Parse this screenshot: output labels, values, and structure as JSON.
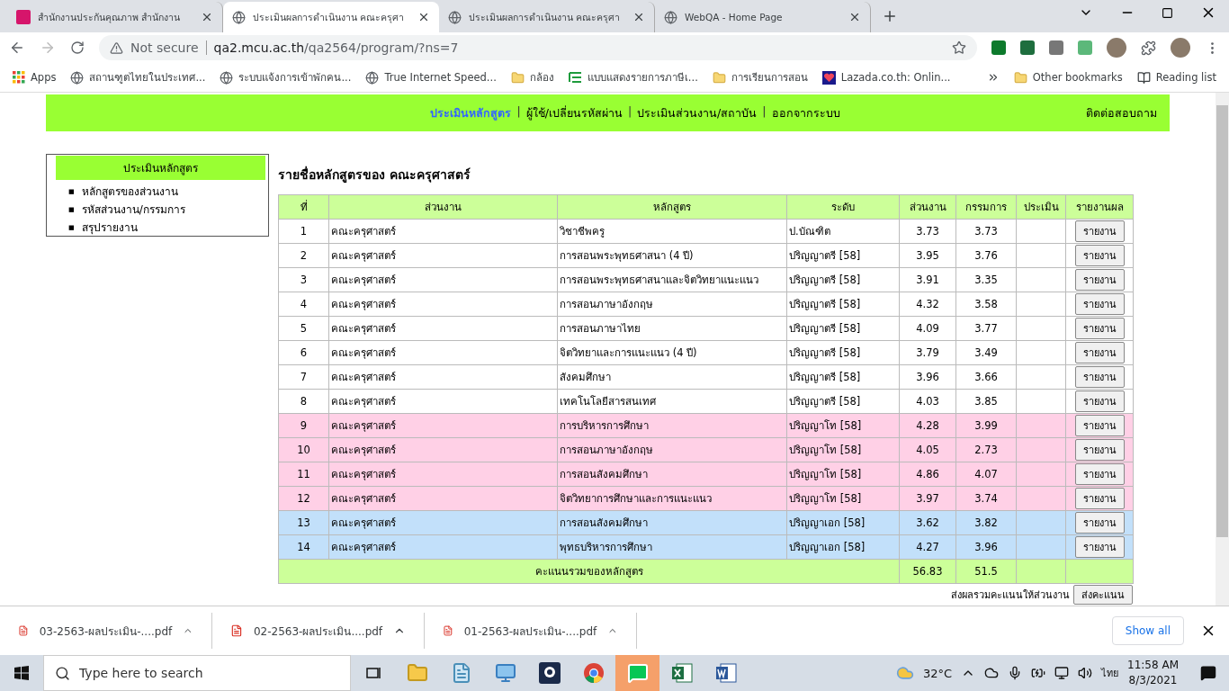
{
  "browser": {
    "tabs": [
      {
        "title": "สำนักงานประกันคุณภาพ สำนักงาน",
        "kind": "logo",
        "selected": false
      },
      {
        "title": "ประเมินผลการดำเนินงาน คณะครุศา",
        "kind": "globe",
        "selected": true
      },
      {
        "title": "ประเมินผลการดำเนินงาน คณะครุศา",
        "kind": "globe",
        "selected": false
      },
      {
        "title": "WebQA - Home Page",
        "kind": "globe",
        "selected": false
      }
    ],
    "address": {
      "security": "Not secure",
      "host": "qa2.mcu.ac.th",
      "path": "/qa2564/program/?ns=7"
    },
    "bookmarks": [
      {
        "label": "Apps",
        "kind": "apps"
      },
      {
        "label": "สถานฑูตไทยในประเทศ...",
        "kind": "globe"
      },
      {
        "label": "ระบบแจ้งการเข้าพักคน...",
        "kind": "globe"
      },
      {
        "label": "True Internet Speed...",
        "kind": "globe"
      },
      {
        "label": "กล้อง",
        "kind": "folder"
      },
      {
        "label": "แบบแสดงรายการภาษีเ...",
        "kind": "list"
      },
      {
        "label": "การเรียนการสอน",
        "kind": "folder"
      },
      {
        "label": "Lazada.co.th: Onlin...",
        "kind": "lazada"
      }
    ],
    "other_bookmarks": "Other bookmarks",
    "reading_list": "Reading list"
  },
  "page": {
    "nav": [
      {
        "label": "ประเมินหลักสูตร",
        "selected": true
      },
      {
        "label": "ผู้ใช้/เปลี่ยนรหัสผ่าน",
        "selected": false
      },
      {
        "label": "ประเมินส่วนงาน/สถาบัน",
        "selected": false
      },
      {
        "label": "ออกจากระบบ",
        "selected": false
      }
    ],
    "nav_separator": "|",
    "contact": "ติดต่อสอบถาม",
    "sidebar": {
      "title": "ประเมินหลักสูตร",
      "bullet": "■",
      "items": [
        "หลักสูตรของส่วนงาน",
        "รหัสส่วนงาน/กรรมการ",
        "สรุปรายงาน"
      ]
    },
    "heading": "รายชื่อหลักสูตรของ คณะครุศาสตร์",
    "table": {
      "columns": [
        "ที่",
        "ส่วนงาน",
        "หลักสูตร",
        "ระดับ",
        "ส่วนงาน",
        "กรรมการ",
        "ประเมิน",
        "รายงานผล"
      ],
      "rows": [
        {
          "no": "1",
          "unit": "คณะครุศาสตร์",
          "program": "วิชาชีพครู",
          "level": "ป.บัณฑิต",
          "unit_score": "3.73",
          "committee_score": "3.73",
          "button": "รายงาน",
          "color": "#ffffff"
        },
        {
          "no": "2",
          "unit": "คณะครุศาสตร์",
          "program": "การสอนพระพุทธศาสนา (4 ปี)",
          "level": "ปริญญาตรี [58]",
          "unit_score": "3.95",
          "committee_score": "3.76",
          "button": "รายงาน",
          "color": "#ffffff"
        },
        {
          "no": "3",
          "unit": "คณะครุศาสตร์",
          "program": "การสอนพระพุทธศาสนาและจิตวิทยาแนะแนว",
          "level": "ปริญญาตรี [58]",
          "unit_score": "3.91",
          "committee_score": "3.35",
          "button": "รายงาน",
          "color": "#ffffff"
        },
        {
          "no": "4",
          "unit": "คณะครุศาสตร์",
          "program": "การสอนภาษาอังกฤษ",
          "level": "ปริญญาตรี [58]",
          "unit_score": "4.32",
          "committee_score": "3.58",
          "button": "รายงาน",
          "color": "#ffffff"
        },
        {
          "no": "5",
          "unit": "คณะครุศาสตร์",
          "program": "การสอนภาษาไทย",
          "level": "ปริญญาตรี [58]",
          "unit_score": "4.09",
          "committee_score": "3.77",
          "button": "รายงาน",
          "color": "#ffffff"
        },
        {
          "no": "6",
          "unit": "คณะครุศาสตร์",
          "program": "จิตวิทยาและการแนะแนว (4 ปี)",
          "level": "ปริญญาตรี [58]",
          "unit_score": "3.79",
          "committee_score": "3.49",
          "button": "รายงาน",
          "color": "#ffffff"
        },
        {
          "no": "7",
          "unit": "คณะครุศาสตร์",
          "program": "สังคมศึกษา",
          "level": "ปริญญาตรี [58]",
          "unit_score": "3.96",
          "committee_score": "3.66",
          "button": "รายงาน",
          "color": "#ffffff"
        },
        {
          "no": "8",
          "unit": "คณะครุศาสตร์",
          "program": "เทคโนโลยีสารสนเทศ",
          "level": "ปริญญาตรี [58]",
          "unit_score": "4.03",
          "committee_score": "3.85",
          "button": "รายงาน",
          "color": "#ffffff"
        },
        {
          "no": "9",
          "unit": "คณะครุศาสตร์",
          "program": "การบริหารการศึกษา",
          "level": "ปริญญาโท [58]",
          "unit_score": "4.28",
          "committee_score": "3.99",
          "button": "รายงาน",
          "color": "#ffd0e6"
        },
        {
          "no": "10",
          "unit": "คณะครุศาสตร์",
          "program": "การสอนภาษาอังกฤษ",
          "level": "ปริญญาโท [58]",
          "unit_score": "4.05",
          "committee_score": "2.73",
          "button": "รายงาน",
          "color": "#ffd0e6"
        },
        {
          "no": "11",
          "unit": "คณะครุศาสตร์",
          "program": "การสอนสังคมศึกษา",
          "level": "ปริญญาโท [58]",
          "unit_score": "4.86",
          "committee_score": "4.07",
          "button": "รายงาน",
          "color": "#ffd0e6"
        },
        {
          "no": "12",
          "unit": "คณะครุศาสตร์",
          "program": "จิตวิทยาการศึกษาและการแนะแนว",
          "level": "ปริญญาโท [58]",
          "unit_score": "3.97",
          "committee_score": "3.74",
          "button": "รายงาน",
          "color": "#ffd0e6"
        },
        {
          "no": "13",
          "unit": "คณะครุศาสตร์",
          "program": "การสอนสังคมศึกษา",
          "level": "ปริญญาเอก [58]",
          "unit_score": "3.62",
          "committee_score": "3.82",
          "button": "รายงาน",
          "color": "#c2e0fa"
        },
        {
          "no": "14",
          "unit": "คณะครุศาสตร์",
          "program": "พุทธบริหารการศึกษา",
          "level": "ปริญญาเอก [58]",
          "unit_score": "4.27",
          "committee_score": "3.96",
          "button": "รายงาน",
          "color": "#c2e0fa"
        }
      ],
      "total": {
        "label": "คะแนนรวมของหลักสูตร",
        "unit_score": "56.83",
        "committee_score": "51.5"
      }
    },
    "submit": {
      "label": "ส่งผลรวมคะแนนให้ส่วนงาน",
      "button": "ส่งคะแนน"
    }
  },
  "downloads": {
    "items": [
      "03-2563-ผลประเมิน-....pdf",
      "02-2563-ผลประเมิน....pdf",
      "01-2563-ผลประเมิน-....pdf"
    ],
    "show_all": "Show all"
  },
  "taskbar": {
    "search_placeholder": "Type here to search",
    "apps": [
      {
        "kind": "task-view",
        "selected": false
      },
      {
        "kind": "folder",
        "selected": false
      },
      {
        "kind": "notepad",
        "selected": false
      },
      {
        "kind": "computer",
        "selected": false
      },
      {
        "kind": "webcam",
        "selected": false
      },
      {
        "kind": "chrome",
        "selected": false
      },
      {
        "kind": "line",
        "selected": true
      },
      {
        "kind": "excel",
        "selected": false
      },
      {
        "kind": "word",
        "selected": false
      }
    ],
    "temperature": "32°C",
    "language": "ไทย",
    "time": "11:58 AM",
    "date": "8/3/2021"
  }
}
